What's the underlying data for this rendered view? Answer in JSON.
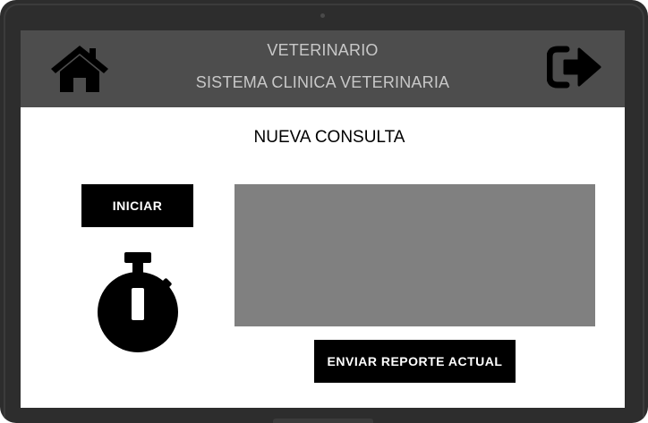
{
  "header": {
    "title": "VETERINARIO",
    "subtitle": "SISTEMA CLINICA VETERINARIA",
    "background_color": "#4d4d4d",
    "home_icon": "home-icon",
    "logout_icon": "sign-out-icon"
  },
  "main": {
    "section_title": "NUEVA CONSULTA",
    "start_button_label": "INICIAR",
    "timer_icon": "stopwatch-icon",
    "report_area_color": "#808080",
    "send_report_button_label": "ENVIAR REPORTE ACTUAL"
  }
}
